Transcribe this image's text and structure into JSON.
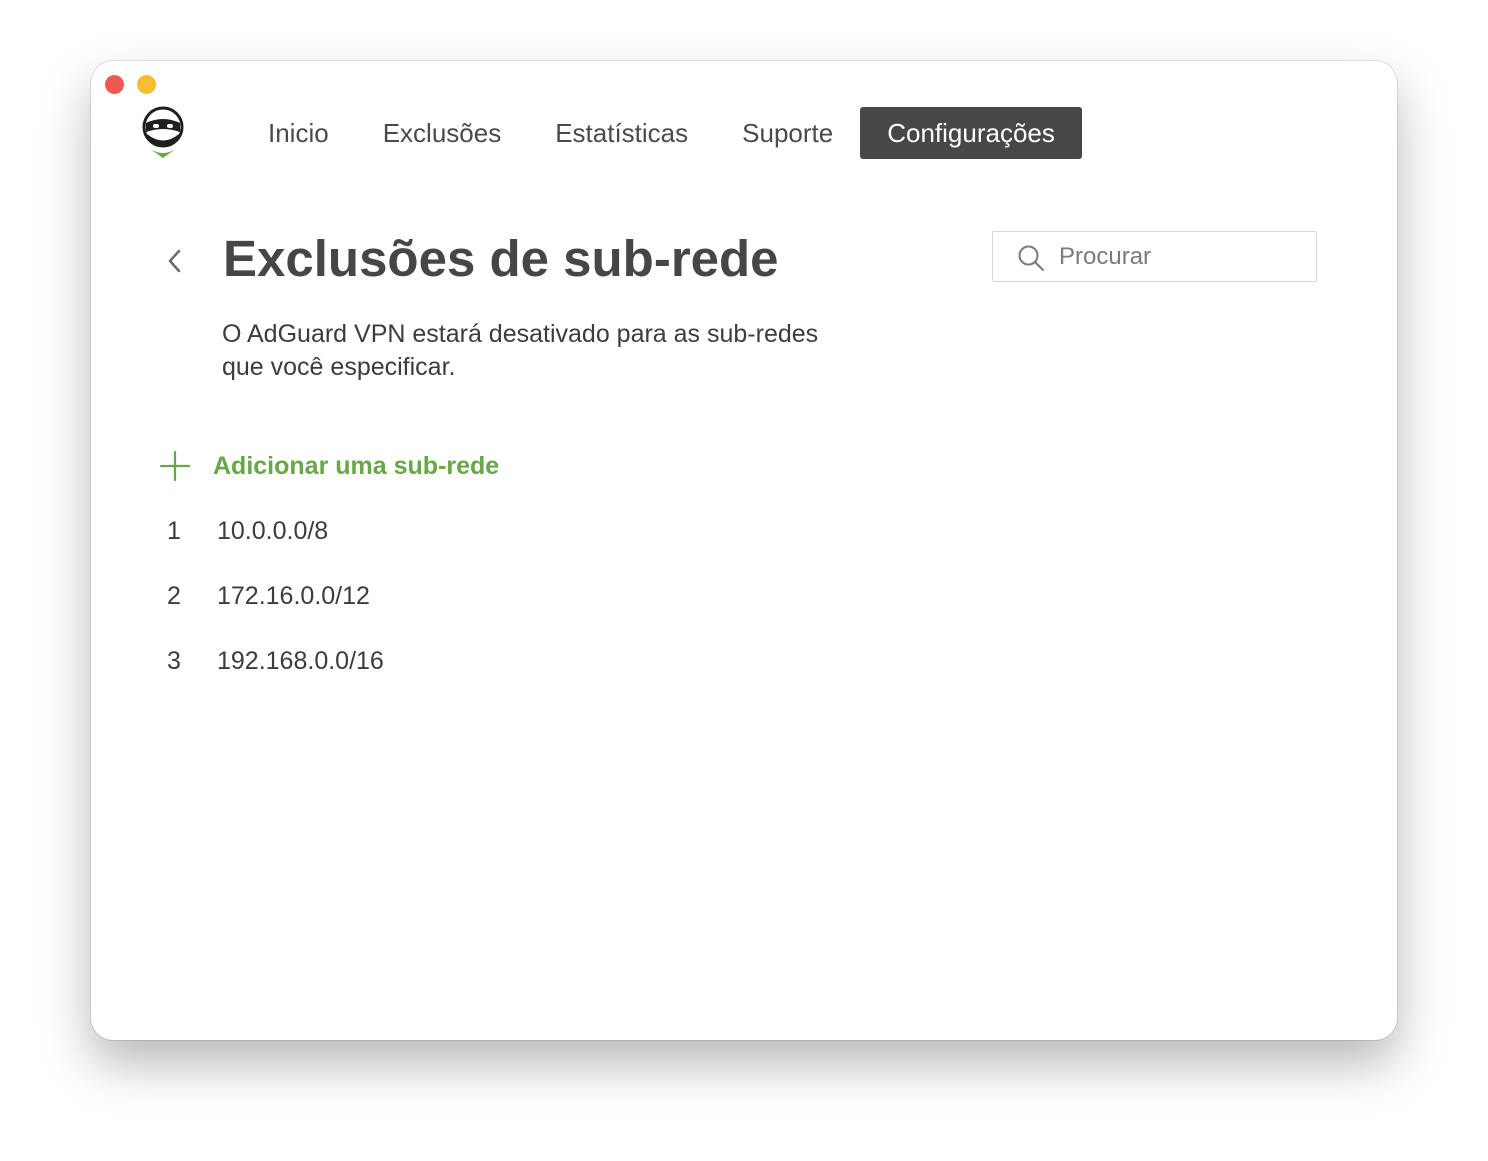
{
  "window": {
    "traffic_lights": [
      "close",
      "minimize"
    ]
  },
  "app": {
    "logo_icon": "adguard-ninja-logo-icon"
  },
  "nav": {
    "items": [
      {
        "label": "Inicio",
        "active": false
      },
      {
        "label": "Exclusões",
        "active": false
      },
      {
        "label": "Estatísticas",
        "active": false
      },
      {
        "label": "Suporte",
        "active": false
      },
      {
        "label": "Configurações",
        "active": true
      }
    ]
  },
  "page": {
    "back_icon": "chevron-left-icon",
    "title": "Exclusões de sub-rede",
    "description_line1": "O AdGuard VPN estará desativado para as sub-redes",
    "description_line2": "que você especificar."
  },
  "search": {
    "icon": "search-icon",
    "placeholder": "Procurar",
    "value": ""
  },
  "add_subnet": {
    "icon": "plus-icon",
    "label": "Adicionar uma sub-rede"
  },
  "subnets": [
    {
      "index": "1",
      "value": "10.0.0.0/8"
    },
    {
      "index": "2",
      "value": "172.16.0.0/12"
    },
    {
      "index": "3",
      "value": "192.168.0.0/16"
    }
  ],
  "colors": {
    "accent_green": "#67a746",
    "active_tab": "#474747",
    "traffic_close": "#ee5a52",
    "traffic_minimize": "#f5bd2f"
  }
}
